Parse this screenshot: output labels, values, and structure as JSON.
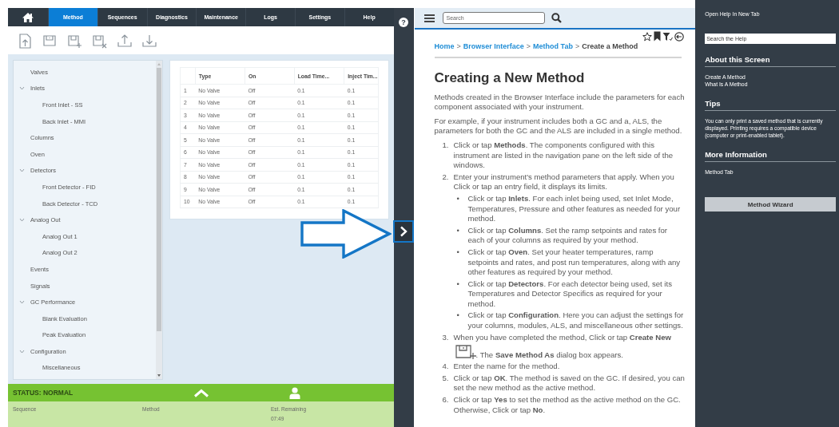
{
  "nav": {
    "tabs": [
      {
        "label": "Method",
        "selected": true
      },
      {
        "label": "Sequences",
        "selected": false
      },
      {
        "label": "Diagnostics",
        "selected": false
      },
      {
        "label": "Maintenance",
        "selected": false
      },
      {
        "label": "Logs",
        "selected": false
      },
      {
        "label": "Settings",
        "selected": false
      },
      {
        "label": "Help",
        "selected": false
      }
    ]
  },
  "tree": [
    {
      "label": "Valves"
    },
    {
      "label": "Inlets",
      "expanded": true,
      "children": [
        {
          "label": "Front Inlet - SS"
        },
        {
          "label": "Back Inlet - MMI"
        }
      ]
    },
    {
      "label": "Columns"
    },
    {
      "label": "Oven"
    },
    {
      "label": "Detectors",
      "expanded": true,
      "children": [
        {
          "label": "Front Detector - FID"
        },
        {
          "label": "Back Detector - TCD"
        }
      ]
    },
    {
      "label": "Analog Out",
      "expanded": true,
      "children": [
        {
          "label": "Analog Out 1"
        },
        {
          "label": "Analog Out 2"
        }
      ]
    },
    {
      "label": "Events"
    },
    {
      "label": "Signals"
    },
    {
      "label": "GC Performance",
      "expanded": true,
      "children": [
        {
          "label": "Blank Evaluation"
        },
        {
          "label": "Peak Evaluation"
        }
      ]
    },
    {
      "label": "Configuration",
      "expanded": true,
      "children": [
        {
          "label": "Miscellaneous"
        }
      ]
    }
  ],
  "table": {
    "columns": [
      "Type",
      "On",
      "Load Time...",
      "Inject Tim..."
    ],
    "rows": [
      {
        "number": "1",
        "cells": [
          "No Valve",
          "Off",
          "0.1",
          "0.1"
        ]
      },
      {
        "number": "2",
        "cells": [
          "No Valve",
          "Off",
          "0.1",
          "0.1"
        ]
      },
      {
        "number": "3",
        "cells": [
          "No Valve",
          "Off",
          "0.1",
          "0.1"
        ]
      },
      {
        "number": "4",
        "cells": [
          "No Valve",
          "Off",
          "0.1",
          "0.1"
        ]
      },
      {
        "number": "5",
        "cells": [
          "No Valve",
          "Off",
          "0.1",
          "0.1"
        ]
      },
      {
        "number": "6",
        "cells": [
          "No Valve",
          "Off",
          "0.1",
          "0.1"
        ]
      },
      {
        "number": "7",
        "cells": [
          "No Valve",
          "Off",
          "0.1",
          "0.1"
        ]
      },
      {
        "number": "8",
        "cells": [
          "No Valve",
          "Off",
          "0.1",
          "0.1"
        ]
      },
      {
        "number": "9",
        "cells": [
          "No Valve",
          "Off",
          "0.1",
          "0.1"
        ]
      },
      {
        "number": "10",
        "cells": [
          "No Valve",
          "Off",
          "0.1",
          "0.1"
        ]
      }
    ]
  },
  "status": {
    "label": "STATUS: NORMAL",
    "fields": [
      {
        "label": "Sequence"
      },
      {
        "label": "Method"
      },
      {
        "label": "Est. Remaining",
        "value": "07:49"
      }
    ]
  },
  "help_icon": "?",
  "help": {
    "search": {
      "placeholder": "Search"
    },
    "breadcrumb": {
      "separator": ">",
      "items": [
        {
          "label": "Home",
          "current": false
        },
        {
          "label": "Browser Interface",
          "current": false
        },
        {
          "label": "Method Tab",
          "current": false
        },
        {
          "label": "Create a Method",
          "current": true
        }
      ]
    },
    "title": "Creating a New Method",
    "paragraphs": [
      "Methods created in the Browser Interface include the parameters for each component associated with your instrument.",
      "For example, if your instrument includes both a GC and a, ALS, the parameters for both the GC and the ALS are included in a single method."
    ],
    "steps": [
      {
        "kind": "text",
        "number": "1.",
        "text": "Click or tap **Methods**. The components configured with this instrument are listed in the navigation pane on the left side of the windows."
      },
      {
        "kind": "text",
        "number": "2.",
        "text": "Enter your instrument's method parameters that apply. When you Click or tap an entry field, it displays its limits.",
        "bullets": [
          {
            "marker": "•",
            "text": "Click or tap **Inlets**. For each inlet being used, set Inlet Mode, Temperatures, Pressure and other features as needed for your method."
          },
          {
            "marker": "•",
            "text": "Click or tap **Columns**. Set the ramp setpoints and rates for each of your columns as required by your method."
          },
          {
            "marker": "•",
            "text": "Click or tap **Oven**. Set your heater temperatures, ramp setpoints and rates, and post run temperatures, along with any other features as required by your method."
          },
          {
            "marker": "•",
            "text": "Click or tap **Detectors**. For each detector being used, set its Temperatures and Detector Specifics as required for your method."
          },
          {
            "marker": "•",
            "text": "Click or tap **Configuration**. Here you can adjust the settings for your columns, modules, ALS, and miscellaneous other settings."
          }
        ]
      },
      {
        "kind": "with-icon",
        "number": "3.",
        "text": "When you have completed the method, Click or tap **Create New**",
        "text_after": ". The **Save Method As** dialog box appears."
      },
      {
        "kind": "text",
        "number": "4.",
        "text": "Enter the name for the method."
      },
      {
        "kind": "text",
        "number": "5.",
        "text": "Click or tap **OK**. The method is saved on the GC. If desired, you can set the new method as the active method."
      },
      {
        "kind": "text",
        "number": "6.",
        "text": "Click or tap **Yes** to set the method as the active method on the GC. Otherwise, Click or tap **No**."
      }
    ]
  },
  "help_sidebar": {
    "open_link": "Open Help In New Tab",
    "search": {
      "placeholder": "Search the Help"
    },
    "sections": [
      {
        "kind": "links",
        "title": "About this Screen",
        "links": [
          "Create A Method",
          "What Is A Method"
        ]
      },
      {
        "kind": "text",
        "title": "Tips",
        "text": "You can only print a saved method that is currently displayed. Printing requires a compatible device (computer or print-enabled tablet)."
      },
      {
        "kind": "links",
        "title": "More Information",
        "links": [
          "Method Tab"
        ]
      }
    ],
    "button": "Method Wizard"
  }
}
